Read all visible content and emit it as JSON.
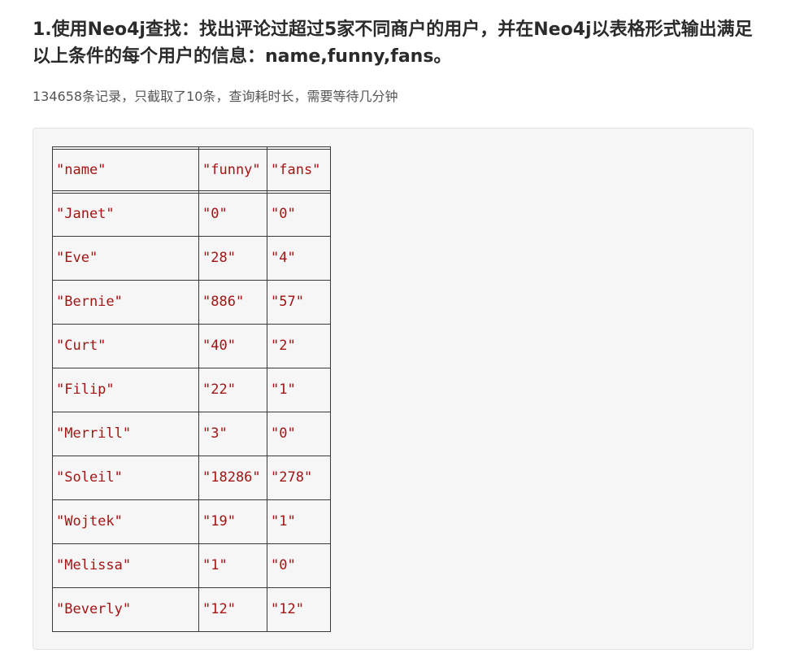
{
  "heading": "1.使用Neo4j查找：找出评论过超过5家不同商户的用户，并在Neo4j以表格形式输出满足以上条件的每个用户的信息：name,funny,fans。",
  "note": "134658条记录，只截取了10条，查询耗时长，需要等待几分钟",
  "table": {
    "columns": [
      "\"name\"",
      "\"funny\"",
      "\"fans\""
    ],
    "rows": [
      [
        "\"Janet\"",
        "\"0\"",
        "\"0\""
      ],
      [
        "\"Eve\"",
        "\"28\"",
        "\"4\""
      ],
      [
        "\"Bernie\"",
        "\"886\"",
        "\"57\""
      ],
      [
        "\"Curt\"",
        "\"40\"",
        "\"2\""
      ],
      [
        "\"Filip\"",
        "\"22\"",
        "\"1\""
      ],
      [
        "\"Merrill\"",
        "\"3\"",
        "\"0\""
      ],
      [
        "\"Soleil\"",
        "\"18286\"",
        "\"278\""
      ],
      [
        "\"Wojtek\"",
        "\"19\"",
        "\"1\""
      ],
      [
        "\"Melissa\"",
        "\"1\"",
        "\"0\""
      ],
      [
        "\"Beverly\"",
        "\"12\"",
        "\"12\""
      ]
    ]
  },
  "colors": {
    "heading": "#2b2b2b",
    "note": "#555555",
    "code_background": "#f6f6f6",
    "code_string": "#a31515",
    "table_border": "#3a3a3a"
  }
}
